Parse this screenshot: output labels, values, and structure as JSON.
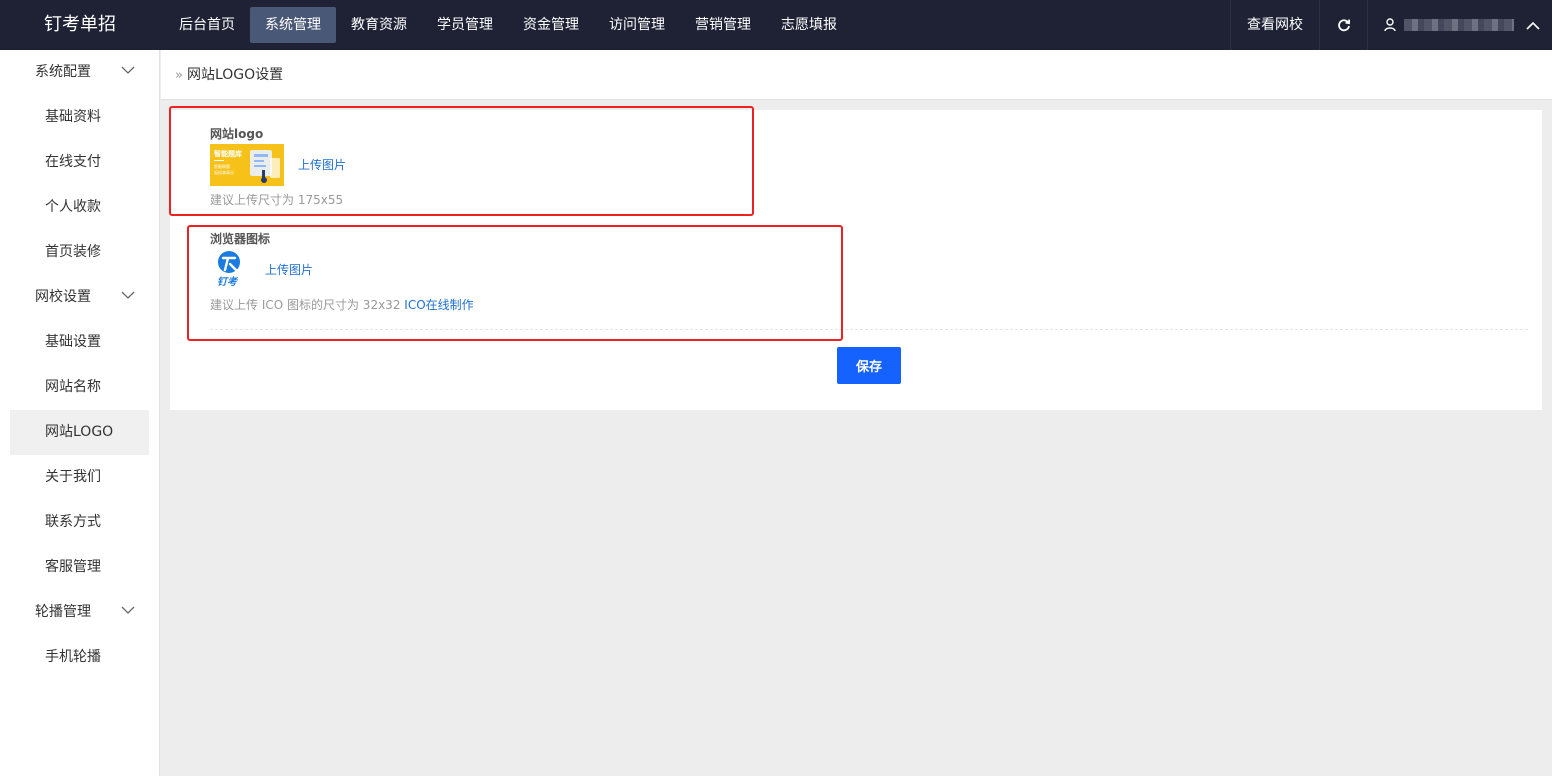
{
  "header": {
    "brand": "钉考单招",
    "nav": [
      {
        "label": "后台首页",
        "active": false
      },
      {
        "label": "系统管理",
        "active": true
      },
      {
        "label": "教育资源",
        "active": false
      },
      {
        "label": "学员管理",
        "active": false
      },
      {
        "label": "资金管理",
        "active": false
      },
      {
        "label": "访问管理",
        "active": false
      },
      {
        "label": "营销管理",
        "active": false
      },
      {
        "label": "志愿填报",
        "active": false
      }
    ],
    "view_site": "查看网校",
    "icons": [
      "refresh-icon",
      "user-icon",
      "chevron-up-icon"
    ]
  },
  "sidebar": {
    "items": [
      {
        "type": "group",
        "label": "系统配置"
      },
      {
        "type": "item",
        "label": "基础资料"
      },
      {
        "type": "item",
        "label": "在线支付"
      },
      {
        "type": "item",
        "label": "个人收款"
      },
      {
        "type": "item",
        "label": "首页装修"
      },
      {
        "type": "group",
        "label": "网校设置"
      },
      {
        "type": "item",
        "label": "基础设置"
      },
      {
        "type": "item",
        "label": "网站名称"
      },
      {
        "type": "item",
        "label": "网站LOGO",
        "active": true
      },
      {
        "type": "item",
        "label": "关于我们"
      },
      {
        "type": "item",
        "label": "联系方式"
      },
      {
        "type": "item",
        "label": "客服管理"
      },
      {
        "type": "group",
        "label": "轮播管理"
      },
      {
        "type": "item",
        "label": "手机轮播"
      }
    ]
  },
  "breadcrumb": {
    "current": "网站LOGO设置"
  },
  "form": {
    "logo": {
      "label": "网站logo",
      "upload": "上传图片",
      "hint": "建议上传尺寸为 175x55",
      "thumb_title": "智能题库",
      "thumb_line1": "智能刷题",
      "thumb_line2": "轻松拿高分"
    },
    "favicon": {
      "label": "浏览器图标",
      "upload": "上传图片",
      "hint": "建议上传 ICO 图标的尺寸为 32x32",
      "hint_link": "ICO在线制作",
      "thumb_text": "钉考"
    },
    "save": "保存"
  },
  "colors": {
    "topbar": "#1f2235",
    "nav_active": "#4a5877",
    "link": "#1f6fd1",
    "primary_button": "#1562ff",
    "highlight_box": "#ee2222"
  }
}
